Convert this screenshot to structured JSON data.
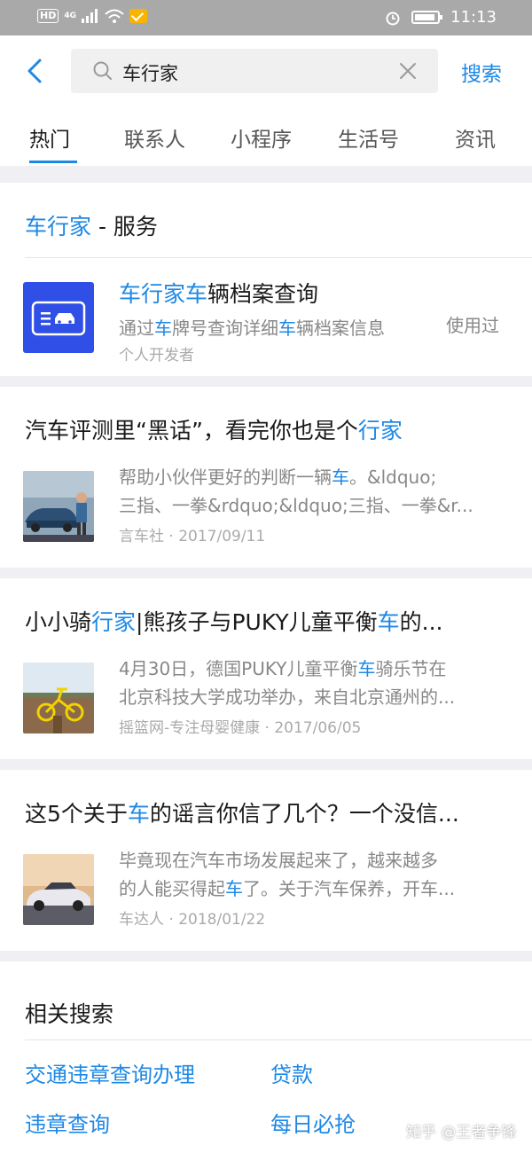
{
  "status_bar": {
    "network": "HD",
    "network_type": "4G",
    "time": "11:13"
  },
  "search": {
    "query": "车行家",
    "button_label": "搜索"
  },
  "tabs": [
    {
      "label": "热门",
      "active": true
    },
    {
      "label": "联系人",
      "active": false
    },
    {
      "label": "小程序",
      "active": false
    },
    {
      "label": "生活号",
      "active": false
    },
    {
      "label": "资讯",
      "active": false
    }
  ],
  "service_section": {
    "title_highlight": "车行家",
    "title_rest": " - 服务",
    "item": {
      "title_highlight": "车行家车",
      "title_rest": "辆档案查询",
      "desc_a": "通过",
      "desc_b": "车",
      "desc_c": "牌号查询详细",
      "desc_d": "车",
      "desc_e": "辆档案信息",
      "developer": "个人开发者",
      "badge": "使用过"
    }
  },
  "articles": [
    {
      "title_a": "汽车评测里“黑话”，看完你也是个",
      "title_b": "行家",
      "title_c": "",
      "title_d": "",
      "title_e": "",
      "line1_a": "帮助小伙伴更好的判断一辆",
      "line1_b": "车",
      "line1_c": "。&ldquo;",
      "line2_a": "三指、一拳&rdquo;&ldquo;三指、一拳&r...",
      "line2_b": "",
      "line2_c": "",
      "meta": "言车社 · 2017/09/11"
    },
    {
      "title_a": "小小骑",
      "title_b": "行家",
      "title_c": "|熊孩子与PUKY儿童平衡",
      "title_d": "车",
      "title_e": "的...",
      "line1_a": "4月30日，德国PUKY儿童平衡",
      "line1_b": "车",
      "line1_c": "骑乐节在",
      "line2_a": "北京科技大学成功举办，来自北京通州的...",
      "line2_b": "",
      "line2_c": "",
      "meta": "摇篮网-专注母婴健康 · 2017/06/05"
    },
    {
      "title_a": "这5个关于",
      "title_b": "车",
      "title_c": "的谣言你信了几个？一个没信...",
      "title_d": "",
      "title_e": "",
      "line1_a": "毕竟现在汽车市场发展起来了，越来越多",
      "line1_b": "",
      "line1_c": "",
      "line2_a": "的人能买得起",
      "line2_b": "车",
      "line2_c": "了。关于汽车保养，开车...",
      "meta": "车达人 · 2018/01/22"
    }
  ],
  "related": {
    "title": "相关搜索",
    "links": [
      "交通违章查询办理",
      "贷款",
      "违章查询",
      "每日必抢"
    ]
  },
  "watermark": "知乎 @王者争锋",
  "colors": {
    "accent": "#1e88e5",
    "service_icon_bg": "#2f4fe6"
  }
}
